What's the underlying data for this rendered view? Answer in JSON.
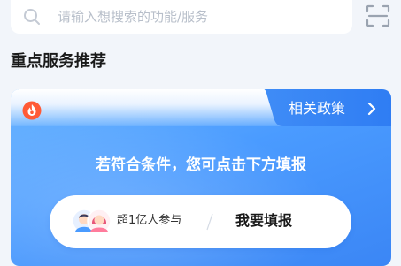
{
  "search": {
    "placeholder": "请输入想搜索的功能/服务"
  },
  "section": {
    "title": "重点服务推荐"
  },
  "card": {
    "policy_tab_label": "相关政策",
    "headline": "若符合条件，您可点击下方填报",
    "participants_text": "超1亿人参与",
    "action_label": "我要填报"
  },
  "colors": {
    "accent": "#4a9bff",
    "badge": "#ff5a36"
  }
}
